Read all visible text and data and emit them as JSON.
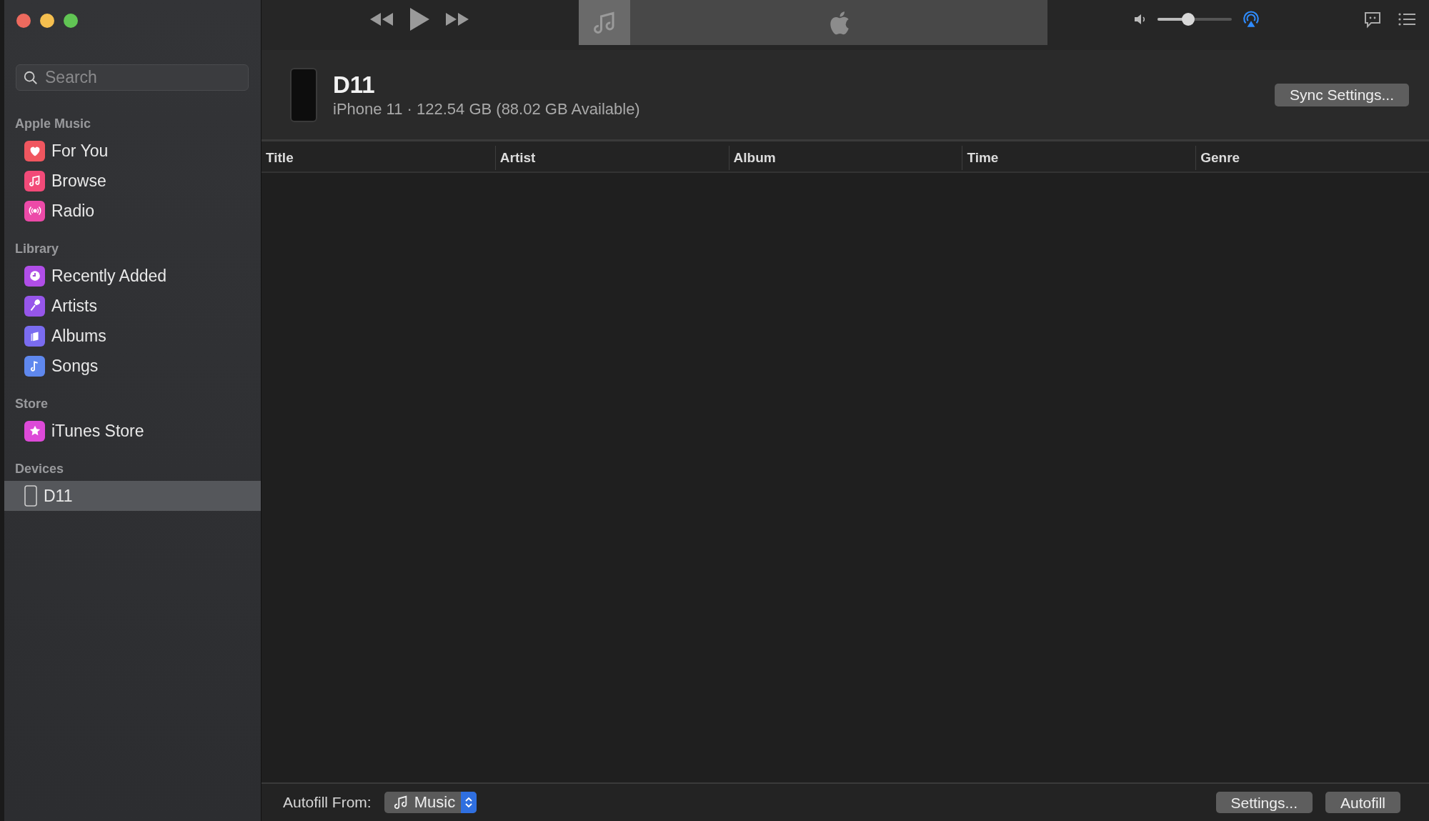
{
  "sidebar": {
    "search": {
      "placeholder": "Search"
    },
    "sections": [
      {
        "title": "Apple Music",
        "items": [
          {
            "label": "For You",
            "color": "#f0565f",
            "selected": false
          },
          {
            "label": "Browse",
            "color": "#f24a78",
            "selected": false
          },
          {
            "label": "Radio",
            "color": "#ec4aa8",
            "selected": false
          }
        ]
      },
      {
        "title": "Library",
        "items": [
          {
            "label": "Recently Added",
            "color": "#b04ee8",
            "selected": false
          },
          {
            "label": "Artists",
            "color": "#9656ea",
            "selected": false
          },
          {
            "label": "Albums",
            "color": "#7a6cf0",
            "selected": false
          },
          {
            "label": "Songs",
            "color": "#5f88ee",
            "selected": false
          }
        ]
      },
      {
        "title": "Store",
        "items": [
          {
            "label": "iTunes Store",
            "color": "#dd4ad8",
            "selected": false
          }
        ]
      },
      {
        "title": "Devices",
        "items": [
          {
            "label": "D11",
            "kind": "device",
            "selected": true
          }
        ]
      }
    ]
  },
  "toolbar": {
    "volume": {
      "level": 0.39
    }
  },
  "device": {
    "name": "D11",
    "details": "iPhone 11 · 122.54 GB (88.02 GB Available)",
    "sync_button": "Sync Settings..."
  },
  "table": {
    "columns": [
      "Title",
      "Artist",
      "Album",
      "Time",
      "Genre"
    ]
  },
  "footer": {
    "autofill_label": "Autofill From:",
    "source": "Music",
    "settings_button": "Settings...",
    "autofill_button": "Autofill"
  }
}
